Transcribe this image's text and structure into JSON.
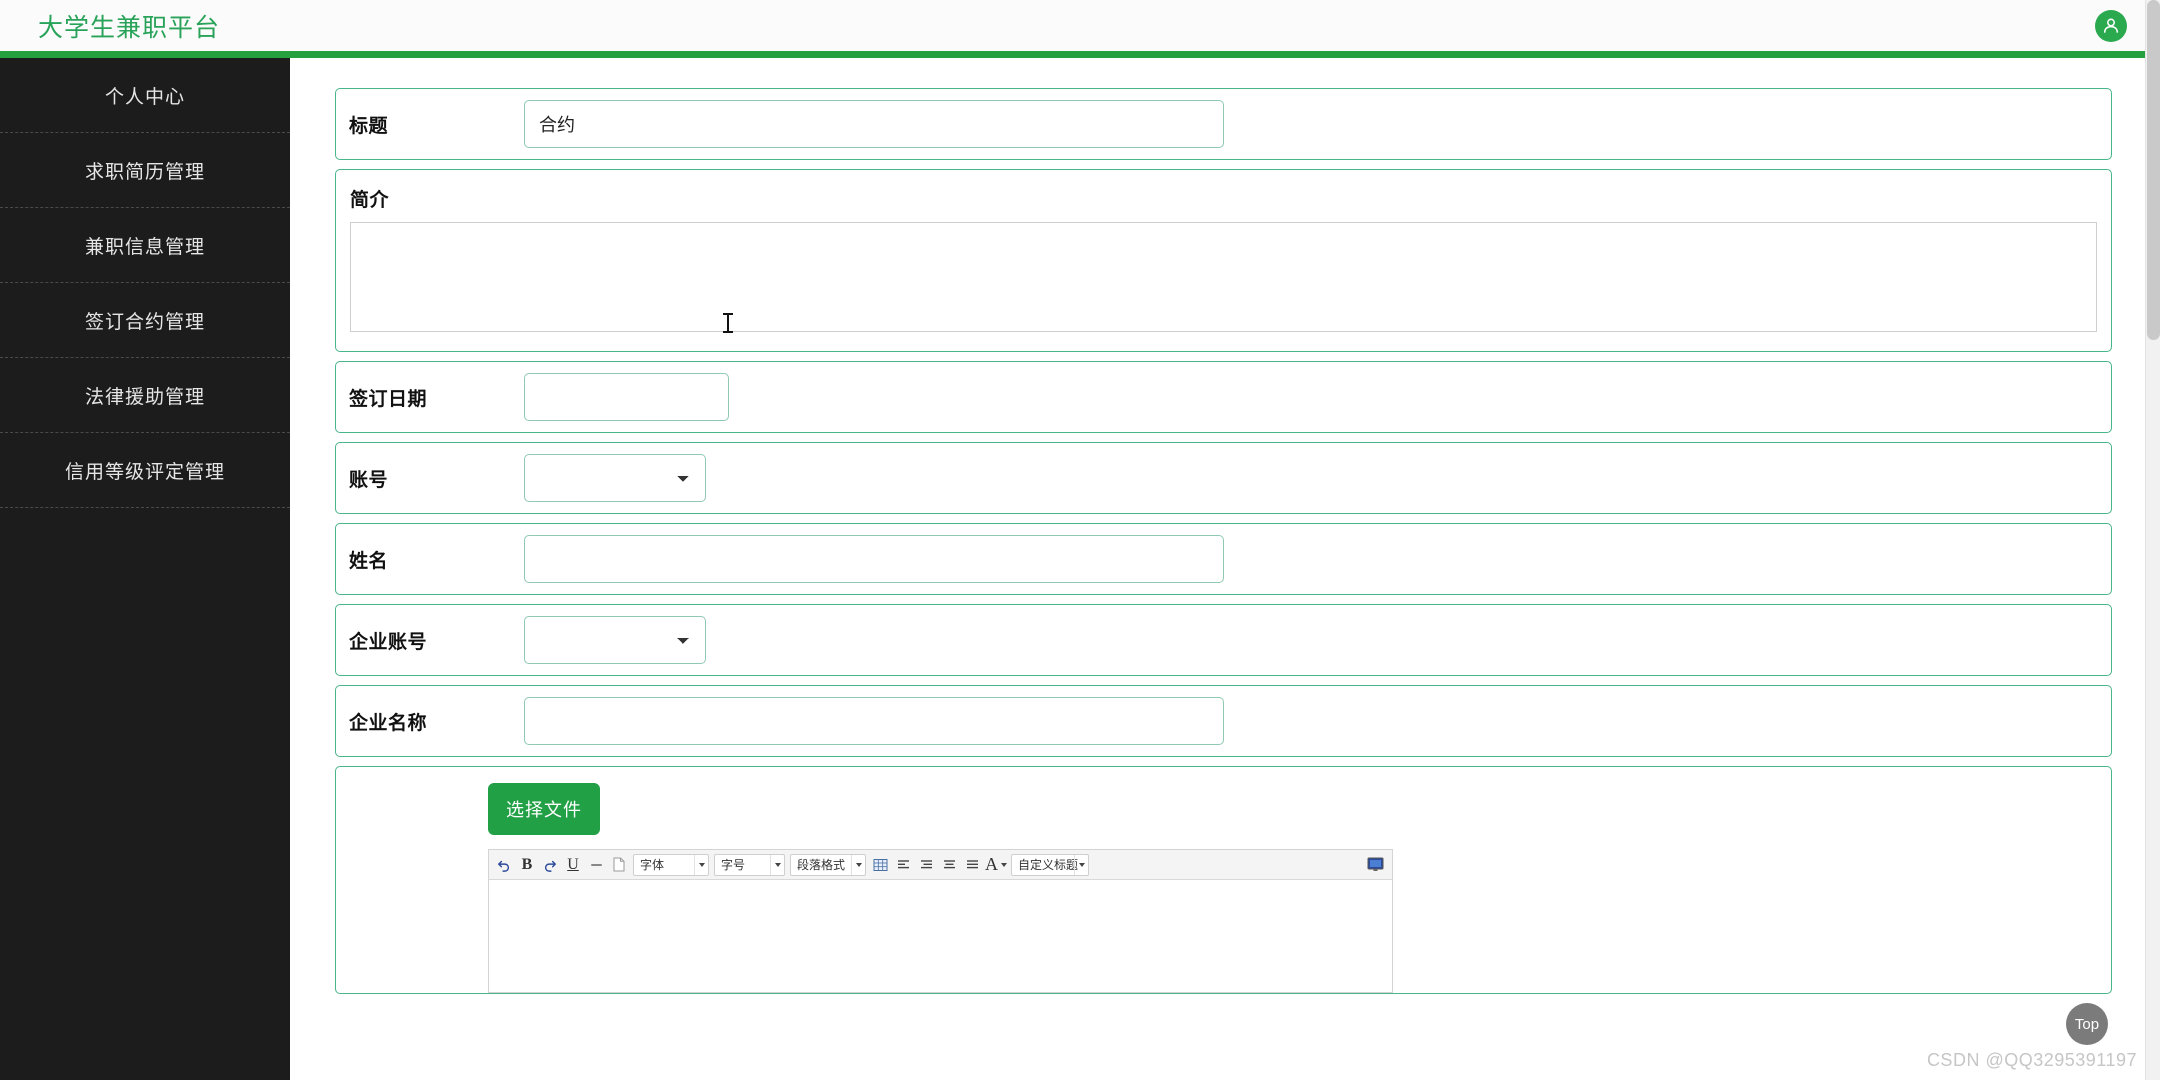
{
  "header": {
    "brand": "大学生兼职平台",
    "avatar_icon": "user-avatar-icon",
    "brand_color": "#2aa35a",
    "bar_color": "#24a03f"
  },
  "sidebar": {
    "items": [
      {
        "label": "个人中心"
      },
      {
        "label": "求职简历管理"
      },
      {
        "label": "兼职信息管理"
      },
      {
        "label": "签订合约管理"
      },
      {
        "label": "法律援助管理"
      },
      {
        "label": "信用等级评定管理"
      }
    ]
  },
  "form": {
    "title": {
      "label": "标题",
      "value": "合约",
      "placeholder": ""
    },
    "intro": {
      "label": "简介",
      "value": "",
      "placeholder": ""
    },
    "sign_date": {
      "label": "签订日期",
      "value": "",
      "placeholder": ""
    },
    "account": {
      "label": "账号",
      "value": "",
      "options": [
        ""
      ]
    },
    "name": {
      "label": "姓名",
      "value": "",
      "placeholder": ""
    },
    "company_account": {
      "label": "企业账号",
      "value": "",
      "options": [
        ""
      ]
    },
    "company_name": {
      "label": "企业名称",
      "value": "",
      "placeholder": ""
    },
    "file_button": {
      "label": "选择文件"
    }
  },
  "editor": {
    "toolbar": {
      "undo": "↰",
      "bold": "B",
      "redo": "↱",
      "underline": "U",
      "strike": "—",
      "page": "▢",
      "font_family": "字体",
      "font_size": "字号",
      "paragraph_format": "段落格式",
      "table": "▦",
      "align_left": "≡",
      "align_center": "≡",
      "align_right": "≡",
      "justify": "≡",
      "font_color": "A",
      "custom_title": "自定义标题",
      "fullscreen": "🖥"
    },
    "body_value": ""
  },
  "footer": {
    "watermark": "CSDN @QQ3295391197",
    "top_button": "Top"
  }
}
